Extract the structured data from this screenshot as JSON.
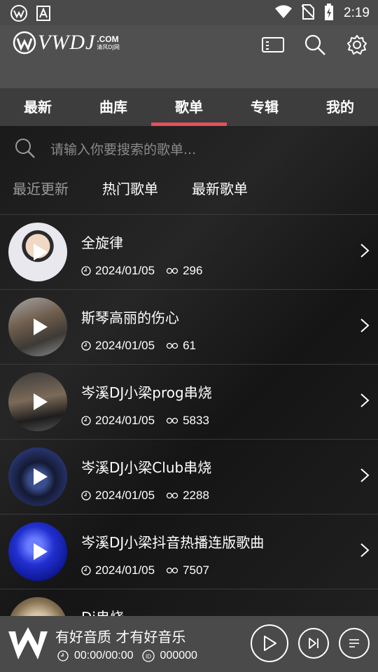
{
  "status_bar": {
    "time": "2:19"
  },
  "header": {
    "logo_text": "VWDJ",
    "logo_com": ".COM",
    "logo_cn": "清风DJ网"
  },
  "tabs": [
    {
      "label": "最新"
    },
    {
      "label": "曲库"
    },
    {
      "label": "歌单"
    },
    {
      "label": "专辑"
    },
    {
      "label": "我的"
    }
  ],
  "active_tab": "歌单",
  "search": {
    "placeholder": "请输入你要搜索的歌单..."
  },
  "filters": [
    {
      "label": "最近更新"
    },
    {
      "label": "热门歌单"
    },
    {
      "label": "最新歌单"
    }
  ],
  "playlists": [
    {
      "title": "全旋律",
      "date": "2024/01/05",
      "count": "296"
    },
    {
      "title": "斯琴高丽的伤心",
      "date": "2024/01/05",
      "count": "61"
    },
    {
      "title": "岑溪DJ小梁prog串烧",
      "date": "2024/01/05",
      "count": "5833"
    },
    {
      "title": "岑溪DJ小梁Club串烧",
      "date": "2024/01/05",
      "count": "2288"
    },
    {
      "title": "岑溪DJ小梁抖音热播连版歌曲",
      "date": "2024/01/05",
      "count": "7507"
    },
    {
      "title": "Dj串烧",
      "date": "",
      "count": ""
    }
  ],
  "player": {
    "title": "有好音质 才有好音乐",
    "time": "00:00/00:00",
    "id": "000000"
  },
  "colors": {
    "accent": "#e84f5a",
    "tab_bg": "#3d3d3d",
    "header_bg": "#505050",
    "player_bg": "#4a4a4a"
  }
}
